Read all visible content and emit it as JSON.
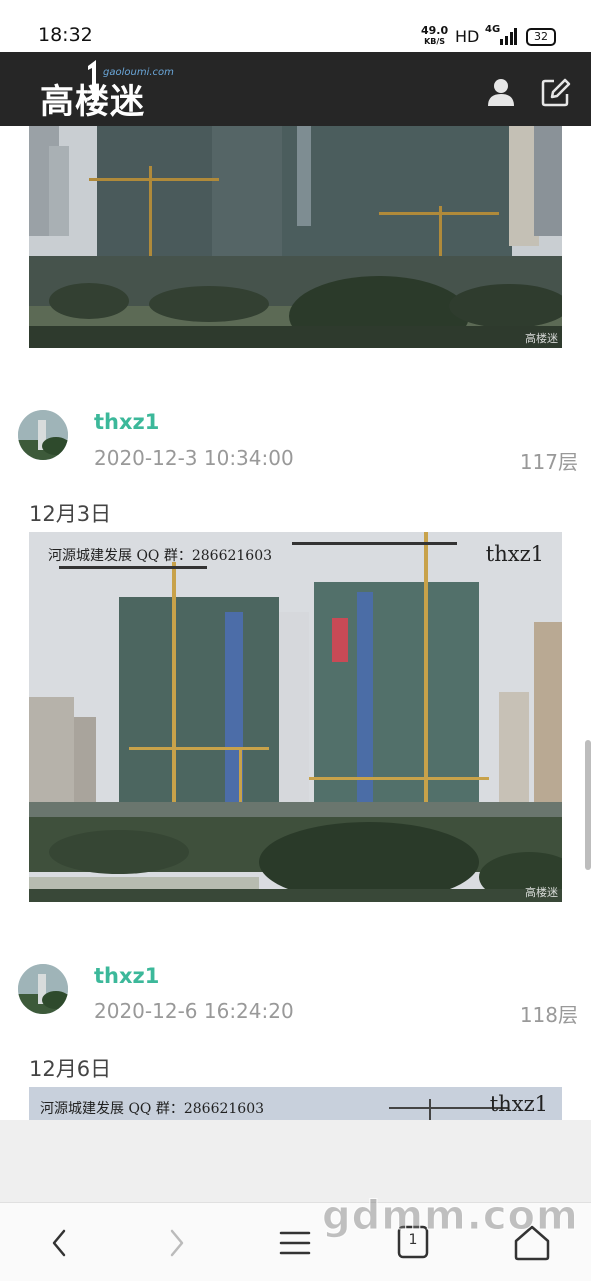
{
  "status_bar": {
    "time": "18:32",
    "net_speed": "49.0",
    "net_unit": "KB/S",
    "hd": "HD",
    "network": "4G",
    "battery": "32"
  },
  "header": {
    "logo_text": "高楼迷",
    "logo_url": "gaoloumi.com",
    "user_icon": "user-icon",
    "edit_icon": "edit-icon"
  },
  "posts": [
    {
      "author": "thxz1",
      "timestamp": "2020-12-3 10:34:00",
      "floor": "117层",
      "text": "12月3日",
      "photo_qq": "河源城建发展 QQ 群：286621603",
      "photo_user": "thxz1",
      "photo_mark": "高楼迷"
    },
    {
      "author": "thxz1",
      "timestamp": "2020-12-6 16:24:20",
      "floor": "118层",
      "text": "12月6日",
      "photo_qq": "河源城建发展 QQ 群：286621603",
      "photo_user": "thxz1"
    }
  ],
  "previous_photo_mark": "高楼迷",
  "bottom_nav": {
    "back": "back-icon",
    "forward": "forward-icon",
    "menu": "menu-icon",
    "tabs_count": "1",
    "home": "home-icon"
  },
  "watermark": "gdmm.com",
  "colors": {
    "header_bg": "#262626",
    "author": "#3cb89a",
    "meta": "#999999"
  }
}
